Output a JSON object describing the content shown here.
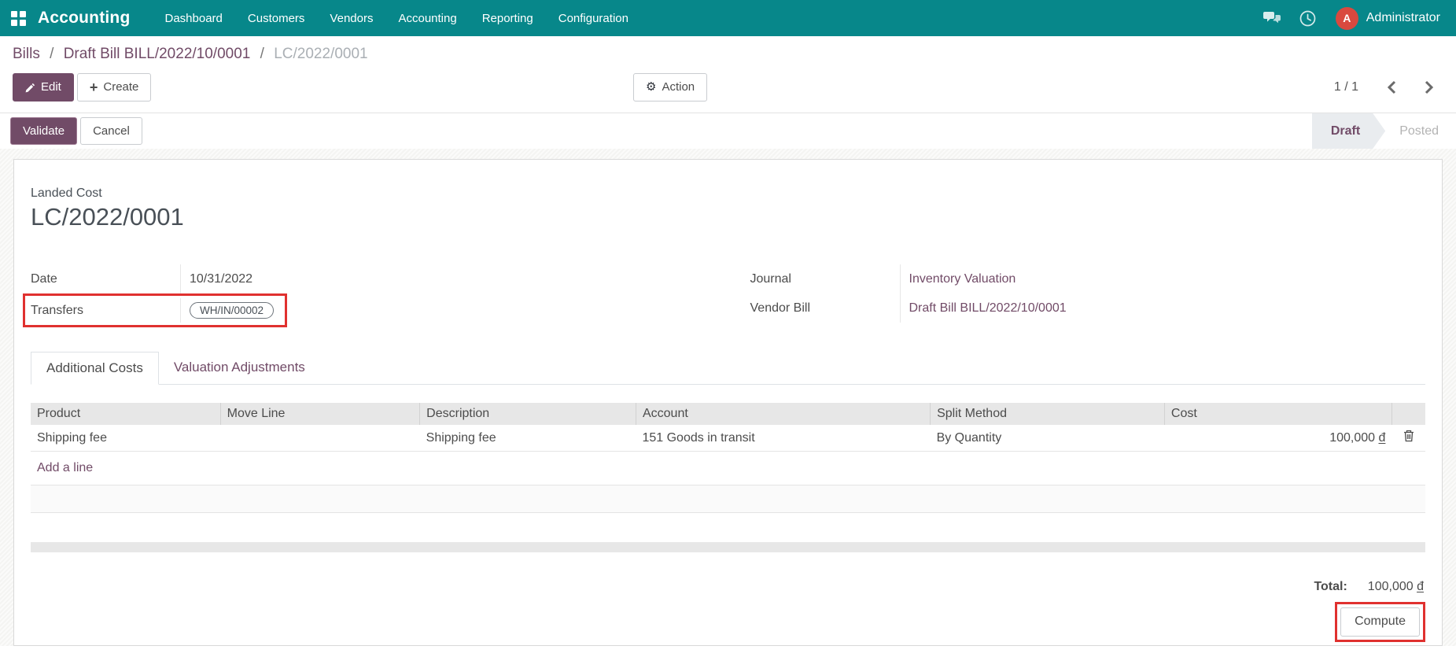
{
  "navbar": {
    "app_name": "Accounting",
    "menu_items": [
      "Dashboard",
      "Customers",
      "Vendors",
      "Accounting",
      "Reporting",
      "Configuration"
    ],
    "avatar_initial": "A",
    "user_name": "Administrator",
    "icons": [
      "apps-grid-icon",
      "chat-icon",
      "activity-clock-icon",
      "avatar"
    ]
  },
  "breadcrumb": {
    "items": [
      "Bills",
      "Draft Bill BILL/2022/10/0001"
    ],
    "current": "LC/2022/0001",
    "separator": "/"
  },
  "control_panel": {
    "edit_label": "Edit",
    "create_label": "Create",
    "create_plus": "+",
    "action_label": "Action",
    "action_gear": "⚙",
    "pager_count": "1 / 1"
  },
  "statusbar": {
    "validate_label": "Validate",
    "cancel_label": "Cancel",
    "states": [
      {
        "label": "Draft",
        "active": true
      },
      {
        "label": "Posted",
        "active": false
      }
    ]
  },
  "form": {
    "subtitle": "Landed Cost",
    "title": "LC/2022/0001",
    "fields": {
      "date": {
        "label": "Date",
        "value": "10/31/2022"
      },
      "transfers": {
        "label": "Transfers",
        "value": "WH/IN/00002",
        "highlighted": true
      },
      "journal": {
        "label": "Journal",
        "value": "Inventory Valuation"
      },
      "vendor_bill": {
        "label": "Vendor Bill",
        "value": "Draft Bill BILL/2022/10/0001"
      }
    },
    "tabs": [
      {
        "label": "Additional Costs",
        "active": true
      },
      {
        "label": "Valuation Adjustments",
        "active": false
      }
    ],
    "table": {
      "columns": [
        "Product",
        "Move Line",
        "Description",
        "Account",
        "Split Method",
        "Cost"
      ],
      "rows": [
        {
          "product": "Shipping fee",
          "move_line": "",
          "description": "Shipping fee",
          "account": "151 Goods in transit",
          "split_method": "By Quantity",
          "cost": "100,000",
          "currency": "đ"
        }
      ],
      "add_line_label": "Add a line"
    },
    "total": {
      "label": "Total:",
      "value": "100,000",
      "currency": "đ"
    },
    "compute_label": "Compute",
    "compute_highlighted": true
  },
  "colors": {
    "navbar_bg": "#07878A",
    "accent_purple": "#714B67",
    "highlight_red": "#E0312F",
    "avatar_bg": "#D9493F",
    "stage_bg": "#E9ECEF"
  }
}
